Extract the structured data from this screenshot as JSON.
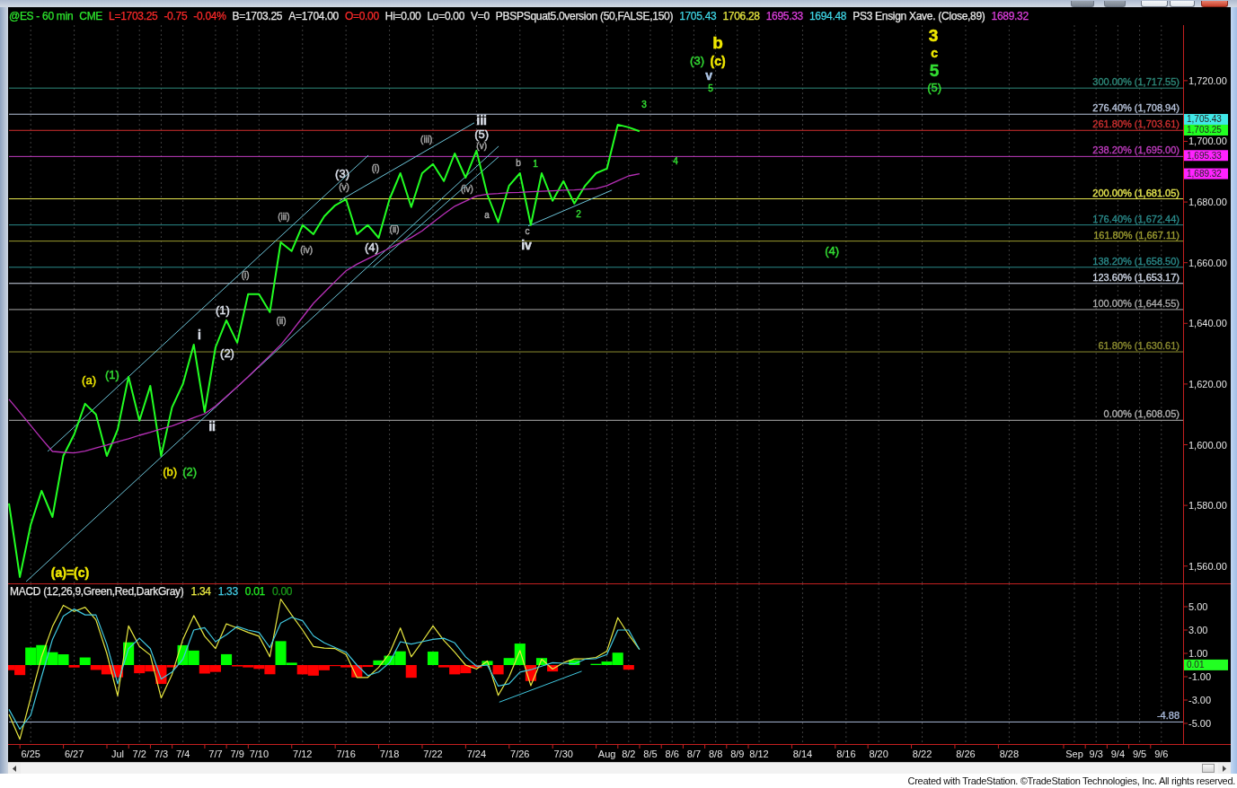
{
  "header": {
    "items": [
      {
        "text": "@ES - 60 min",
        "color": "#2ee82e"
      },
      {
        "text": "CME",
        "color": "#2ee82e"
      },
      {
        "text": "L=1703.25",
        "color": "#ff2a2a"
      },
      {
        "text": "-0.75",
        "color": "#ff2a2a"
      },
      {
        "text": "-0.04%",
        "color": "#ff2a2a"
      },
      {
        "text": "B=1703.25",
        "color": "#e8e8e8"
      },
      {
        "text": "A=1704.00",
        "color": "#e8e8e8"
      },
      {
        "text": "O=0.00",
        "color": "#ff2a2a"
      },
      {
        "text": "Hi=0.00",
        "color": "#e8e8e8"
      },
      {
        "text": "Lo=0.00",
        "color": "#e8e8e8"
      },
      {
        "text": "V=0",
        "color": "#e8e8e8"
      },
      {
        "text": "PBSPSquat5.0version (50,FALSE,150)",
        "color": "#e8e8e8"
      },
      {
        "text": "1705.43",
        "color": "#40d8e8"
      },
      {
        "text": "1706.28",
        "color": "#e8e840"
      },
      {
        "text": "1695.33",
        "color": "#e040e0"
      },
      {
        "text": "1694.48",
        "color": "#40d8e8"
      },
      {
        "text": "PS3 Ensign Xave. (Close,89)",
        "color": "#e8e8e8"
      },
      {
        "text": "1689.32",
        "color": "#e040e0"
      }
    ]
  },
  "price_panel": {
    "chart_data": {
      "type": "line",
      "grid": true,
      "ylim": [
        1554.3,
        1738.3
      ],
      "yticks": [
        {
          "value": 1720,
          "label": "1,720.00"
        },
        {
          "value": 1700,
          "label": "1,700.00"
        },
        {
          "value": 1680,
          "label": "1,680.00"
        },
        {
          "value": 1660,
          "label": "1,660.00"
        },
        {
          "value": 1640,
          "label": "1,640.00"
        },
        {
          "value": 1620,
          "label": "1,620.00"
        },
        {
          "value": 1600,
          "label": "1,600.00"
        },
        {
          "value": 1580,
          "label": "1,580.00"
        },
        {
          "value": 1560,
          "label": "1,560.00"
        }
      ],
      "categories": [
        null,
        null,
        null,
        null,
        null,
        null,
        null,
        null,
        null,
        null,
        null,
        null,
        null,
        null,
        null,
        null,
        null,
        null,
        null,
        null,
        null,
        null,
        null,
        null,
        null,
        null,
        null,
        null,
        null,
        null,
        null,
        null,
        null,
        null,
        null,
        null,
        null,
        null,
        null,
        null,
        null,
        null,
        null,
        null,
        null,
        null,
        null,
        null,
        null,
        null,
        null,
        null,
        null,
        null,
        null,
        null,
        null,
        null,
        null,
        null,
        null,
        null,
        null,
        null,
        null,
        null,
        null,
        null,
        null,
        null,
        null,
        null,
        null,
        null,
        null,
        null,
        null,
        null,
        null,
        null,
        null,
        null,
        null,
        null,
        null,
        null,
        null,
        null,
        null,
        null,
        null,
        null,
        null,
        null,
        null,
        null,
        null,
        null,
        null,
        null,
        null,
        null,
        null,
        null,
        null,
        null,
        null,
        null,
        null
      ],
      "series": [
        {
          "color": "#22ff22",
          "values": [
            1580.7,
            1556.4,
            1573.6,
            1584.8,
            1576.2,
            1596.3,
            1603.4,
            1613.5,
            1610,
            1596.3,
            1605,
            1622.4,
            1607.9,
            1619.4,
            1596.3,
            1612.3,
            1620,
            1633,
            1610.8,
            1632.1,
            1641,
            1633.6,
            1649.6,
            1649.6,
            1643.7,
            1666.7,
            1663.8,
            1672.4,
            1669.4,
            1675.3,
            1678.9,
            1680.9,
            1669.4,
            1672.4,
            1668.2,
            1680.9,
            1689.5,
            1678.3,
            1689.5,
            1692.5,
            1686.9,
            1696,
            1688,
            1696.9,
            1682.4,
            1673.3,
            1685.4,
            1689.5,
            1672.4,
            1689.5,
            1680.4,
            1686.9,
            1679.5,
            1685.4,
            1689.5,
            1691,
            1705.5,
            1704.6,
            1703.3,
            null,
            null,
            null,
            null,
            null,
            null,
            null,
            null,
            null,
            null,
            null,
            null,
            null,
            null,
            null,
            null,
            null,
            null,
            null,
            null,
            null,
            null,
            null,
            null,
            null,
            null,
            null,
            null,
            null,
            null,
            null,
            null,
            null,
            null,
            null,
            null,
            null,
            null,
            null,
            null,
            null,
            null,
            null,
            null,
            null,
            null,
            null,
            null,
            null,
            null
          ]
        },
        {
          "color": "#b830b8",
          "values": [
            1615,
            1610.7,
            1606.3,
            1602,
            1597.8,
            1597.5,
            1597.3,
            1597.9,
            1598.9,
            1599.9,
            1601,
            1602,
            1603.1,
            1604.1,
            1605.2,
            1606.2,
            1607.5,
            1608.9,
            1610.2,
            1612.7,
            1615.9,
            1619.1,
            1622.4,
            1625.9,
            1629.4,
            1632.9,
            1637.3,
            1642,
            1646.6,
            1650.2,
            1653.8,
            1657.3,
            1659.5,
            1661.3,
            1663,
            1664.8,
            1666.5,
            1668.3,
            1670.5,
            1673.3,
            1676,
            1678.6,
            1680.3,
            1682,
            1682.6,
            1682.8,
            1683.1,
            1683.2,
            1683.4,
            1683.5,
            1683.7,
            1683.9,
            1684,
            1684.2,
            1684.4,
            1685.4,
            1687,
            1688.6,
            1689.3,
            null,
            null,
            null,
            null,
            null,
            null,
            null,
            null,
            null,
            null,
            null,
            null,
            null,
            null,
            null,
            null,
            null,
            null,
            null,
            null,
            null,
            null,
            null,
            null,
            null,
            null,
            null,
            null,
            null,
            null,
            null,
            null,
            null,
            null,
            null,
            null,
            null,
            null,
            null,
            null,
            null,
            null,
            null,
            null,
            null,
            null,
            null,
            null,
            null,
            null
          ]
        }
      ],
      "ref_lines": [
        {
          "axis": "y",
          "value": 1717.55,
          "label": "300.00% (1,717.55)",
          "color": "#2e8b7b"
        },
        {
          "axis": "y",
          "value": 1708.94,
          "label": "276.40% (1,708.94)",
          "color": "#b8c4dc"
        },
        {
          "axis": "y",
          "value": 1703.61,
          "label": "261.80% (1,703.61)",
          "color": "#d03030"
        },
        {
          "axis": "y",
          "value": 1695,
          "label": "238.20% (1,695.00)",
          "color": "#c03cc0"
        },
        {
          "axis": "y",
          "value": 1681.05,
          "label": "200.00% (1,681.05)",
          "color": "#e8e850"
        },
        {
          "axis": "y",
          "value": 1672.44,
          "label": "176.40% (1,672.44)",
          "color": "#2a8a8a"
        },
        {
          "axis": "y",
          "value": 1667.11,
          "label": "161.80% (1,667.11)",
          "color": "#9c9c30"
        },
        {
          "axis": "y",
          "value": 1658.5,
          "label": "138.20% (1,658.50)",
          "color": "#2a8a8a"
        },
        {
          "axis": "y",
          "value": 1653.17,
          "label": "123.60% (1,653.17)",
          "color": "#d0d8e8"
        },
        {
          "axis": "y",
          "value": 1644.55,
          "label": "100.00% (1,644.55)",
          "color": "#a8a8a8"
        },
        {
          "axis": "y",
          "value": 1630.61,
          "label": "61.80% (1,630.61)",
          "color": "#8c8c30"
        },
        {
          "axis": "y",
          "value": 1608.05,
          "label": "0.00% (1,608.05)",
          "color": "#b0b0b0"
        }
      ]
    },
    "wave_labels": [
      {
        "text": "(a)=(c)",
        "kind": "major",
        "color": "#f0e800"
      },
      {
        "text": "(a)",
        "kind": "intermediate",
        "color": "#f0e800"
      },
      {
        "text": "(1)",
        "kind": "intermediate",
        "color": "#33dd33"
      },
      {
        "text": "(b)",
        "kind": "intermediate",
        "color": "#f0e800"
      },
      {
        "text": "(2)",
        "kind": "intermediate",
        "color": "#33dd33"
      },
      {
        "text": "i",
        "kind": "major",
        "color": "#dde2ec"
      },
      {
        "text": "ii",
        "kind": "major",
        "color": "#dde2ec"
      },
      {
        "text": "(1)",
        "kind": "intermediate",
        "color": "#dde2ec"
      },
      {
        "text": "(2)",
        "kind": "intermediate",
        "color": "#dde2ec"
      },
      {
        "text": "(i)",
        "kind": "minor",
        "color": "#a8a8a8"
      },
      {
        "text": "(ii)",
        "kind": "minor",
        "color": "#a8a8a8"
      },
      {
        "text": "(iii)",
        "kind": "minor",
        "color": "#a8a8a8"
      },
      {
        "text": "(iv)",
        "kind": "minor",
        "color": "#a8a8a8"
      },
      {
        "text": "(3)",
        "kind": "intermediate",
        "color": "#dde2ec"
      },
      {
        "text": "(v)",
        "kind": "minor",
        "color": "#a8a8a8"
      },
      {
        "text": "(i)",
        "kind": "minor",
        "color": "#a8a8a8"
      },
      {
        "text": "(4)",
        "kind": "intermediate",
        "color": "#dde2ec"
      },
      {
        "text": "(ii)",
        "kind": "minor",
        "color": "#a8a8a8"
      },
      {
        "text": "(iii)",
        "kind": "minor",
        "color": "#a8a8a8"
      },
      {
        "text": "(iv)",
        "kind": "minor",
        "color": "#a8a8a8"
      },
      {
        "text": "iii",
        "kind": "major",
        "color": "#dde2ec"
      },
      {
        "text": "(5)",
        "kind": "intermediate",
        "color": "#dde2ec"
      },
      {
        "text": "(v)",
        "kind": "minor",
        "color": "#a8a8a8"
      },
      {
        "text": "a",
        "kind": "minor",
        "color": "#a8a8a8"
      },
      {
        "text": "b",
        "kind": "minor",
        "color": "#a8a8a8"
      },
      {
        "text": "1",
        "kind": "minor",
        "color": "#33dd33"
      },
      {
        "text": "c",
        "kind": "minor",
        "color": "#a8a8a8"
      },
      {
        "text": "iv",
        "kind": "major",
        "color": "#dde2ec"
      },
      {
        "text": "2",
        "kind": "minor",
        "color": "#33dd33"
      },
      {
        "text": "3",
        "kind": "minor",
        "color": "#33dd33"
      },
      {
        "text": "4",
        "kind": "minor",
        "color": "#33dd33"
      },
      {
        "text": "(3)",
        "kind": "intermediate",
        "color": "#33dd33"
      },
      {
        "text": "b",
        "kind": "primary",
        "color": "#f0e800"
      },
      {
        "text": "(c)",
        "kind": "major",
        "color": "#f0e800"
      },
      {
        "text": "v",
        "kind": "major",
        "color": "#b0c8e8"
      },
      {
        "text": "5",
        "kind": "minor",
        "color": "#33dd33"
      },
      {
        "text": "(4)",
        "kind": "intermediate",
        "color": "#33dd33"
      },
      {
        "text": "3",
        "kind": "primary",
        "color": "#f0e800"
      },
      {
        "text": "c",
        "kind": "major",
        "color": "#f0e800"
      },
      {
        "text": "5",
        "kind": "primary",
        "color": "#33dd33"
      },
      {
        "text": "(5)",
        "kind": "intermediate",
        "color": "#33dd33"
      }
    ],
    "axis_markers": [
      {
        "label": "1,705.43",
        "color": "#40e8e8"
      },
      {
        "label": "1,703.25",
        "color": "#22ff22"
      },
      {
        "label": "1,695.33",
        "color": "#ff22ff"
      },
      {
        "label": "1,689.32",
        "color": "#ff22ff"
      }
    ]
  },
  "macd_panel": {
    "legend": [
      {
        "text": "MACD (12,26,9,Green,Red,DarkGray)",
        "color": "#e8e8e8"
      },
      {
        "text": "1.34",
        "color": "#e8e840"
      },
      {
        "text": "1.33",
        "color": "#40c8e0"
      },
      {
        "text": "0.01",
        "color": "#22ee22"
      },
      {
        "text": "0.00",
        "color": "#1a9a1a"
      }
    ],
    "chart_data": {
      "type": "line",
      "grid": true,
      "ylim": [
        -6.77,
        7
      ],
      "categories": [
        null,
        null,
        "6/25",
        null,
        null,
        null,
        "6/27",
        null,
        null,
        null,
        "Jul",
        null,
        "7/2",
        null,
        "7/3",
        null,
        "7/4",
        null,
        null,
        "7/7",
        null,
        "7/9",
        null,
        "7/10",
        null,
        null,
        null,
        "7/12",
        null,
        null,
        null,
        "7/16",
        null,
        null,
        null,
        "7/18",
        null,
        null,
        null,
        "7/22",
        null,
        null,
        null,
        "7/24",
        null,
        null,
        null,
        "7/26",
        null,
        null,
        null,
        "7/30",
        null,
        null,
        null,
        "Aug",
        null,
        "8/2",
        null,
        "8/5",
        null,
        "8/6",
        null,
        "8/7",
        null,
        "8/8",
        null,
        "8/9",
        null,
        "8/12",
        null,
        null,
        null,
        "8/14",
        null,
        null,
        null,
        "8/16",
        null,
        null,
        "8/20",
        null,
        null,
        null,
        "8/22",
        null,
        null,
        null,
        "8/26",
        null,
        null,
        null,
        "8/28",
        null,
        null,
        null,
        null,
        null,
        "Sep",
        null,
        "9/3",
        null,
        "9/4",
        null,
        "9/5",
        null,
        "9/6",
        null,
        null
      ],
      "yticks": [
        {
          "value": 5,
          "label": "5.00"
        },
        {
          "value": 3,
          "label": "3.00"
        },
        {
          "value": 1,
          "label": "1.00"
        },
        {
          "value": -1,
          "label": "-1.00"
        },
        {
          "value": -3,
          "label": "-3.00"
        },
        {
          "value": -5,
          "label": "-5.00"
        }
      ],
      "series": [
        {
          "color": "#e8e840",
          "values": [
            -4.24,
            -6.36,
            -2.8,
            0.71,
            3.3,
            5.12,
            4.59,
            4.95,
            3.88,
            1,
            -2.65,
            3.35,
            1.6,
            0.85,
            -2.82,
            -0.8,
            2.2,
            4.24,
            2.47,
            1.41,
            3.53,
            3.18,
            2.8,
            2.47,
            0.71,
            5.65,
            4.3,
            3,
            1.59,
            1.45,
            1.41,
            0.9,
            -1.06,
            -1.06,
            -0.2,
            1,
            3.18,
            0.71,
            2,
            3.35,
            2.1,
            1.1,
            0,
            -0.35,
            0.35,
            -2.6,
            -1,
            1.24,
            -1.77,
            0.5,
            -0.35,
            0.2,
            0.53,
            0.53,
            0.65,
            1.2,
            4.06,
            2.6,
            1.34,
            null,
            null,
            null,
            null,
            null,
            null,
            null,
            null,
            null,
            null,
            null,
            null,
            null,
            null,
            null,
            null,
            null,
            null,
            null,
            null,
            null,
            null,
            null,
            null,
            null,
            null,
            null,
            null,
            null,
            null,
            null,
            null,
            null,
            null,
            null,
            null,
            null,
            null,
            null,
            null,
            null,
            null,
            null,
            null,
            null,
            null,
            null,
            null,
            null,
            null
          ]
        },
        {
          "color": "#40c8e0",
          "values": [
            -3.8,
            -5.5,
            -4.3,
            -1,
            2.2,
            4.2,
            4.8,
            4.3,
            4.3,
            1.8,
            -1.6,
            1.4,
            2.3,
            1.4,
            -1.2,
            -0.6,
            0.5,
            3,
            3.2,
            2,
            2.6,
            3.3,
            3,
            2.8,
            1.5,
            3.6,
            4.1,
            3.8,
            2.5,
            1.9,
            1.5,
            1.1,
            0,
            -0.9,
            -0.6,
            0.2,
            2,
            1.8,
            2,
            2.2,
            2.3,
            1.9,
            0.7,
            -0.1,
            0,
            -1.8,
            -1.6,
            -0.6,
            -0.4,
            -0.1,
            0.2,
            0.15,
            0.1,
            0.5,
            0.55,
            0.9,
            3,
            3,
            1.33,
            null,
            null,
            null,
            null,
            null,
            null,
            null,
            null,
            null,
            null,
            null,
            null,
            null,
            null,
            null,
            null,
            null,
            null,
            null,
            null,
            null,
            null,
            null,
            null,
            null,
            null,
            null,
            null,
            null,
            null,
            null,
            null,
            null,
            null,
            null,
            null,
            null,
            null,
            null,
            null,
            null,
            null,
            null,
            null,
            null,
            null,
            null,
            null,
            null,
            null
          ]
        }
      ],
      "ref_lines": [
        {
          "axis": "y",
          "value": -4.88,
          "label": "-4.88",
          "color": "#a8b8d8"
        }
      ]
    },
    "axis_markers": [
      {
        "label": "0.01",
        "color": "#22ff22"
      }
    ]
  },
  "footer": {
    "text": "Created with TradeStation. ©TradeStation Technologies, Inc. All rights reserved."
  }
}
